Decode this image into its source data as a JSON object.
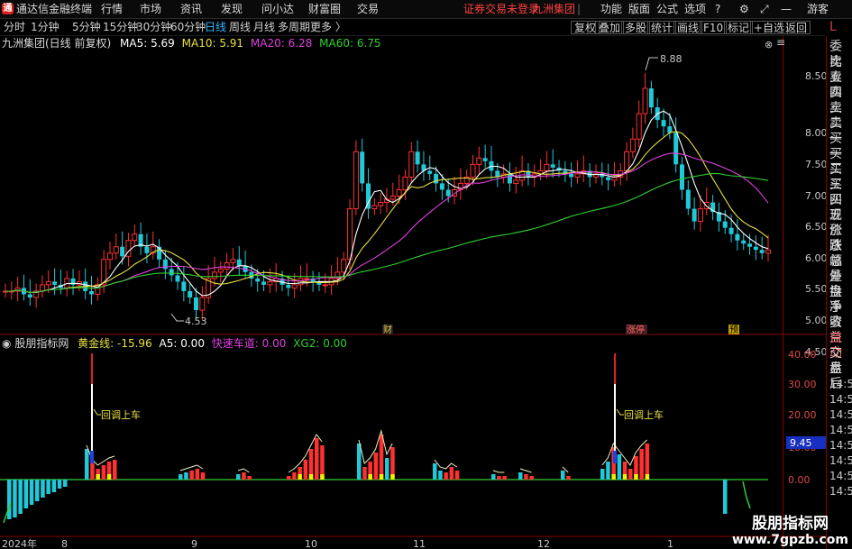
{
  "window": {
    "app_title": "通达信金融终端",
    "menu": [
      "行情",
      "市场",
      "资讯",
      "发现",
      "问小达",
      "财富圈",
      "交易"
    ],
    "login_warning": "证券交易未登录",
    "stock_name_top": "九洲集团",
    "right_menu": [
      "功能",
      "版面",
      "公式",
      "选项"
    ],
    "guest": "游客"
  },
  "toolbar": {
    "periods": [
      "分时",
      "1分钟",
      "5分钟",
      "15分钟",
      "30分钟",
      "60分钟",
      "日线",
      "周线",
      "月线",
      "多周期",
      "更多 〉"
    ],
    "active_period": "日线",
    "buttons": [
      "复权",
      "叠加",
      "多股",
      "统计",
      "画线",
      "F10",
      "标记",
      "+自选",
      "返回"
    ]
  },
  "main_chart": {
    "title": "九洲集团(日线 前复权)",
    "ma_labels": [
      {
        "text": "MA5: 5.69",
        "color": "#ffffff"
      },
      {
        "text": "MA10: 5.91",
        "color": "#e8e040"
      },
      {
        "text": "MA20: 6.28",
        "color": "#e040e0"
      },
      {
        "text": "MA60: 6.75",
        "color": "#30d030"
      }
    ],
    "high_label": "8.88",
    "low_label": "4.53",
    "event_markers": [
      "财",
      "涨停",
      "预"
    ],
    "price_ticks": [
      "8.50",
      "8.00",
      "7.50",
      "7.00",
      "6.50",
      "6.00",
      "5.50",
      "5.00",
      "4.50"
    ]
  },
  "indicator": {
    "name": "股朋指标网",
    "values": [
      {
        "text": "黄金线: -15.96",
        "color": "#e8e040"
      },
      {
        "text": "A5: 0.00",
        "color": "#ffffff"
      },
      {
        "text": "快速车道: 0.00",
        "color": "#e040e0"
      },
      {
        "text": "XG2: 0.00",
        "color": "#30d030"
      }
    ],
    "annotations": [
      "回调上车",
      "回调上车"
    ],
    "ticks": [
      "40.00",
      "30.00",
      "20.00",
      "10.00",
      "0.00"
    ],
    "current_value": "9.45"
  },
  "date_axis": [
    "2024年",
    "8",
    "9",
    "10",
    "11",
    "12",
    "1"
  ],
  "right_panel": {
    "corner": "L",
    "items": [
      "委比",
      "卖五",
      "卖四",
      "卖三",
      "卖二",
      "卖一",
      "买一",
      "买二",
      "买三",
      "买四",
      "买五",
      "现价",
      "涨跌",
      "涨幅",
      "总量",
      "外盘",
      "换手",
      "净资",
      "收益",
      "自动",
      "交易",
      "盘后",
      "14:56",
      "14:56",
      "14:56",
      "14:56",
      "14:56",
      "14:56",
      "14:56",
      "14:56"
    ]
  },
  "watermark": {
    "line1": "股朋指标网",
    "line2": "www.7gpzb.com"
  },
  "colors": {
    "up": "#ff3030",
    "down": "#20c8d8",
    "ma5": "#ffffff",
    "ma10": "#e8e040",
    "ma20": "#e040e0",
    "ma60": "#30d030",
    "frame": "#8a0000"
  },
  "chart_data": {
    "type": "candlestick",
    "closes": [
      5.0,
      5.0,
      5.05,
      4.95,
      4.9,
      5.0,
      5.1,
      5.15,
      5.1,
      5.05,
      5.2,
      5.1,
      5.15,
      5.0,
      4.95,
      5.1,
      5.5,
      5.6,
      5.7,
      5.55,
      5.8,
      5.9,
      5.7,
      5.6,
      5.7,
      5.5,
      5.35,
      5.25,
      5.15,
      5.0,
      4.9,
      4.7,
      4.9,
      5.2,
      5.3,
      5.35,
      5.45,
      5.5,
      5.4,
      5.3,
      5.2,
      5.15,
      5.1,
      5.15,
      5.2,
      5.1,
      5.05,
      5.1,
      5.2,
      5.2,
      5.15,
      5.1,
      5.1,
      5.2,
      5.3,
      5.5,
      6.3,
      7.2,
      6.7,
      6.3,
      6.35,
      6.4,
      6.45,
      6.5,
      6.6,
      6.8,
      7.2,
      7.0,
      6.9,
      6.85,
      6.7,
      6.6,
      6.5,
      6.6,
      6.7,
      6.8,
      7.0,
      7.1,
      7.05,
      6.9,
      6.8,
      6.85,
      6.7,
      6.75,
      6.9,
      6.8,
      6.85,
      6.9,
      7.0,
      6.95,
      6.9,
      6.85,
      6.8,
      6.85,
      6.9,
      6.8,
      6.85,
      6.8,
      6.75,
      6.8,
      6.9,
      7.2,
      7.4,
      7.8,
      8.2,
      7.9,
      7.7,
      7.6,
      7.5,
      7.0,
      6.6,
      6.3,
      6.1,
      6.3,
      6.4,
      6.25,
      6.1,
      6.0,
      5.9,
      5.8,
      5.75,
      5.7,
      5.65,
      5.6,
      5.65
    ]
  }
}
